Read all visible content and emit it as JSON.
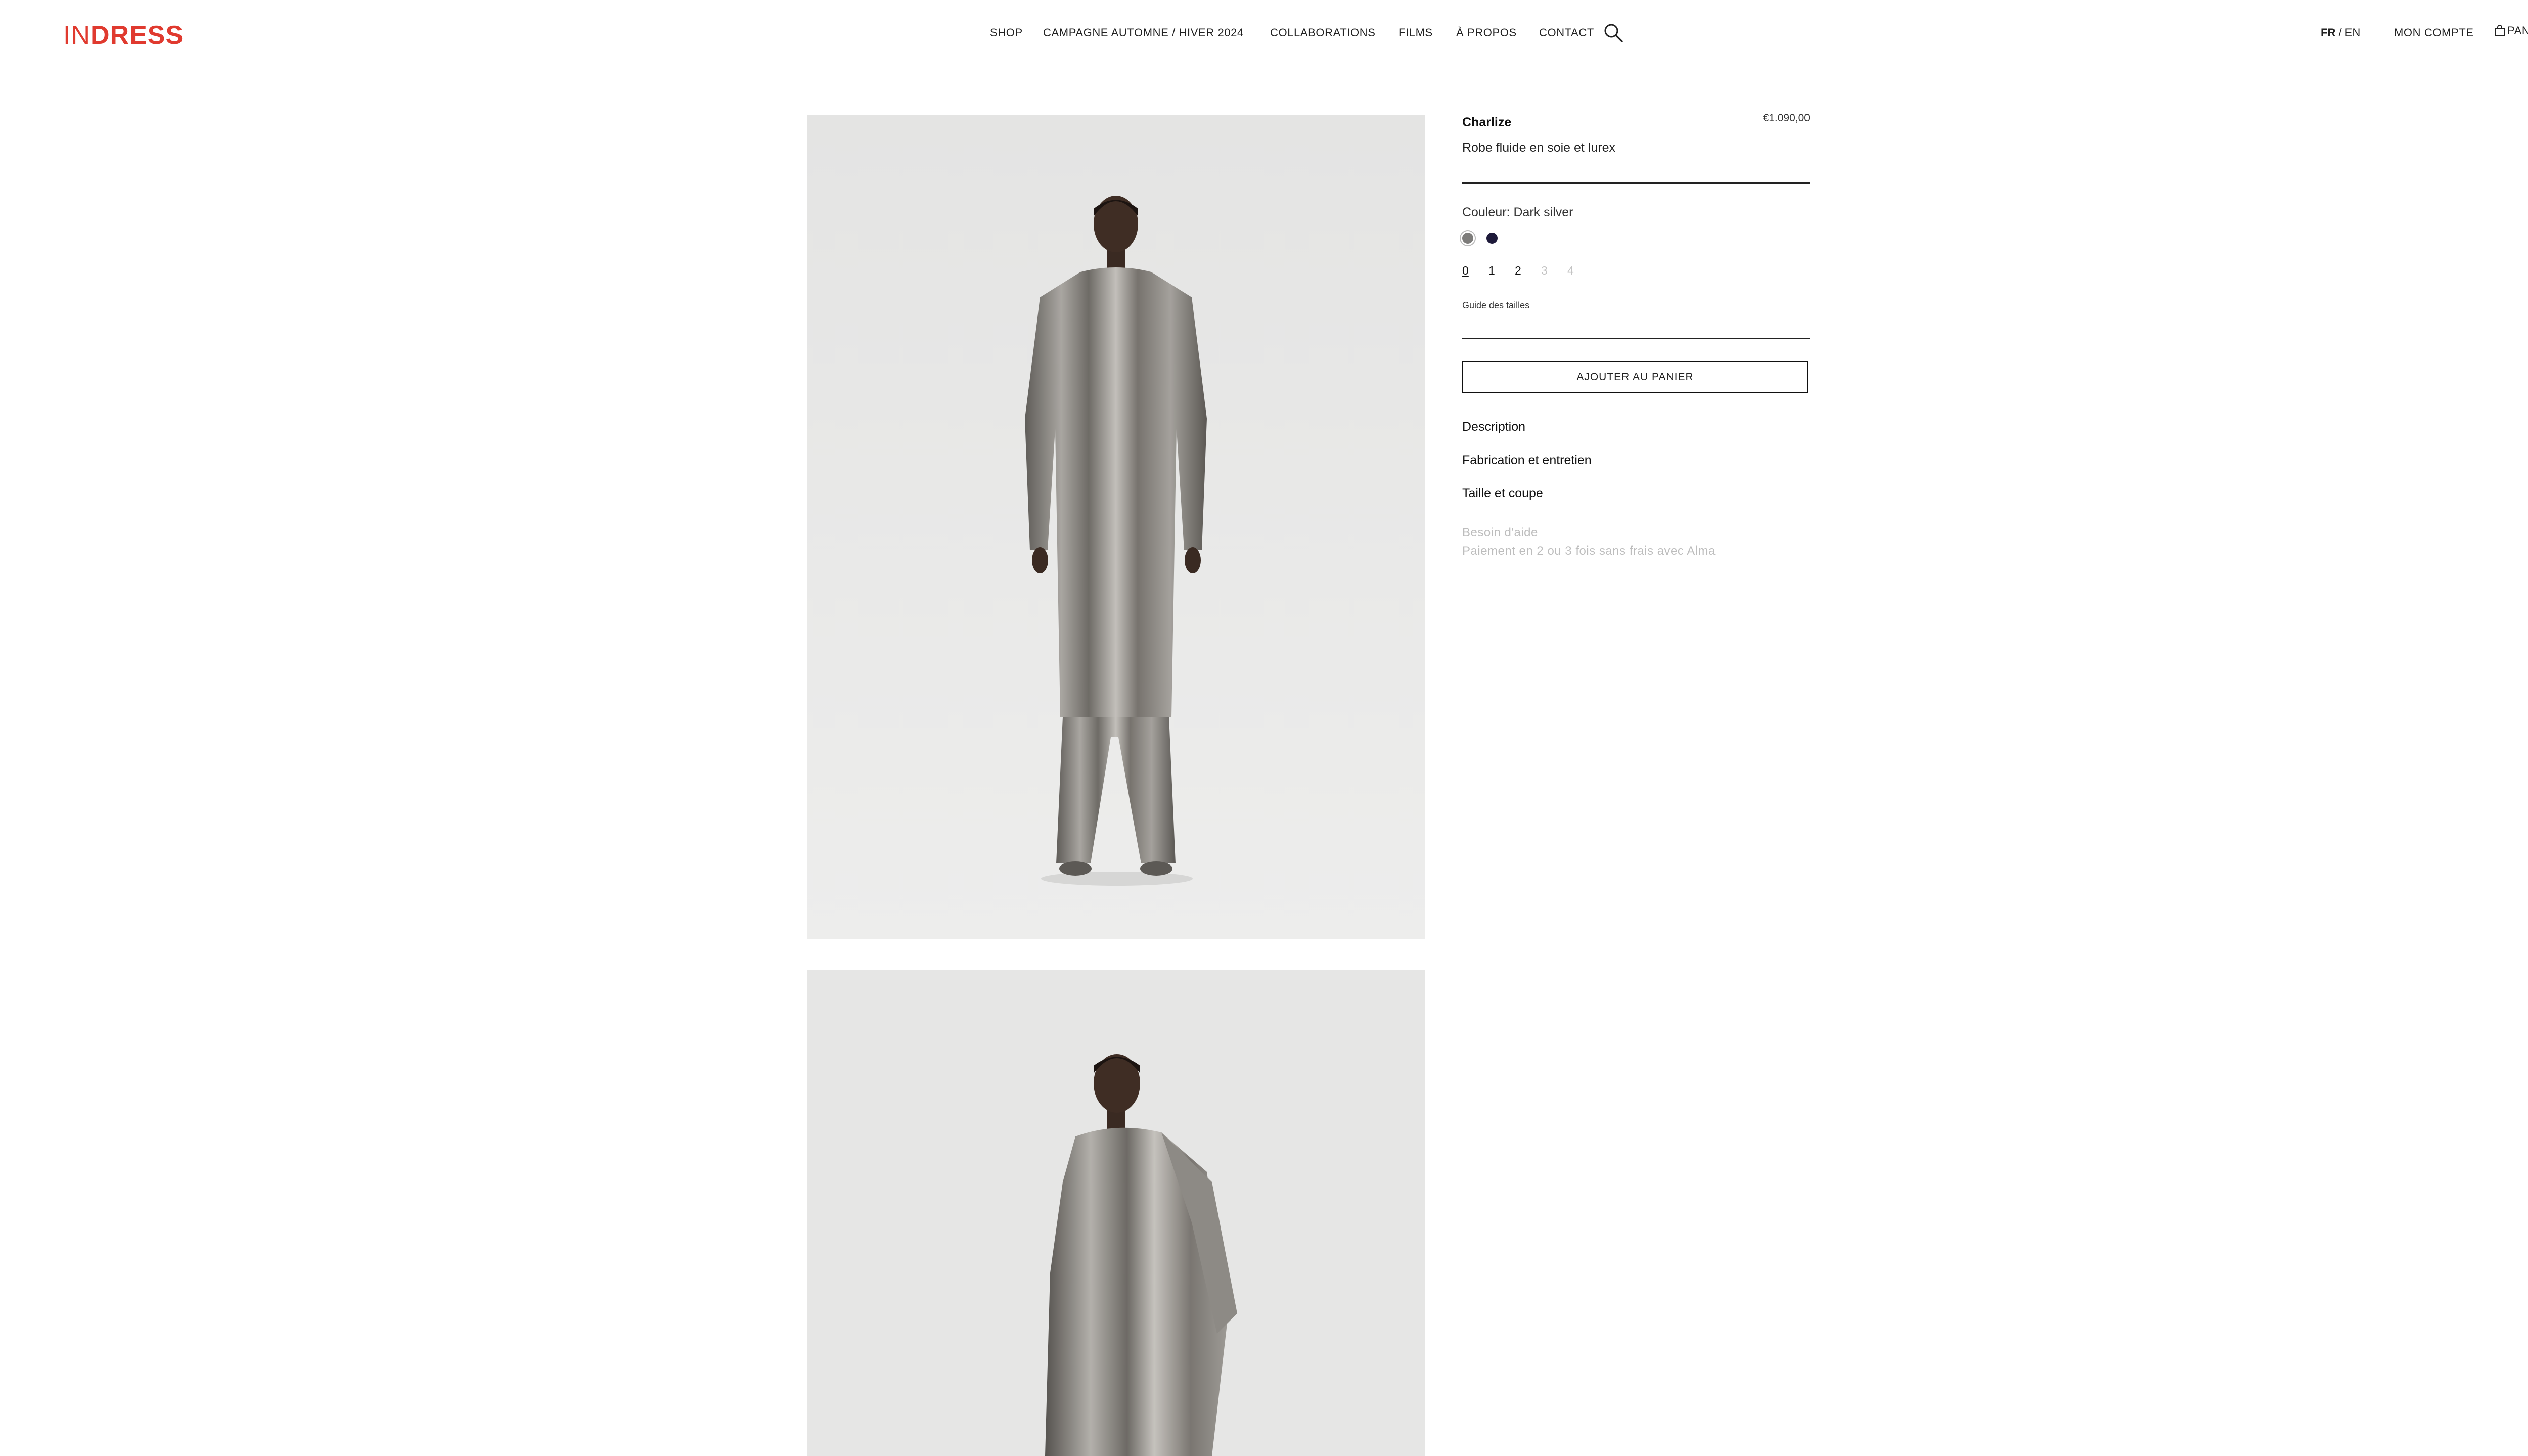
{
  "header": {
    "logo_part1": "IN",
    "logo_part2": "DRESS",
    "nav": [
      "SHOP",
      "CAMPAGNE AUTOMNE / HIVER 2024",
      "COLLABORATIONS",
      "FILMS",
      "À PROPOS",
      "CONTACT"
    ],
    "search_icon": "search-icon",
    "lang_active": "FR",
    "lang_separator": " / ",
    "lang_other": "EN",
    "account_label": "MON COMPTE",
    "cart_icon": "bag-icon",
    "cart_label": "PANIER"
  },
  "product": {
    "name": "Charlize",
    "price": "€1.090,00",
    "subtitle": "Robe fluide en soie et lurex",
    "color_label": "Couleur: Dark silver",
    "swatches": [
      {
        "name": "Dark silver",
        "color": "#7d7c7a",
        "selected": true
      },
      {
        "name": "Navy",
        "color": "#1e1a3a",
        "selected": false
      }
    ],
    "sizes": [
      {
        "label": "0",
        "available": true,
        "selected": true
      },
      {
        "label": "1",
        "available": true,
        "selected": false
      },
      {
        "label": "2",
        "available": true,
        "selected": false
      },
      {
        "label": "3",
        "available": false,
        "selected": false
      },
      {
        "label": "4",
        "available": false,
        "selected": false
      }
    ],
    "size_guide": "Guide des tailles",
    "add_to_cart": "AJOUTER AU PANIER",
    "accordions": [
      "Description",
      "Fabrication et entretien",
      "Taille et coupe"
    ],
    "help": [
      "Besoin d'aide",
      "Paiement en 2 ou 3 fois sans frais avec Alma"
    ]
  },
  "colors": {
    "brand": "#e03a2f",
    "text": "#111111",
    "muted": "#bdbdbd",
    "photo_bg": "#e9e9e8",
    "garment": "#8c8984"
  }
}
